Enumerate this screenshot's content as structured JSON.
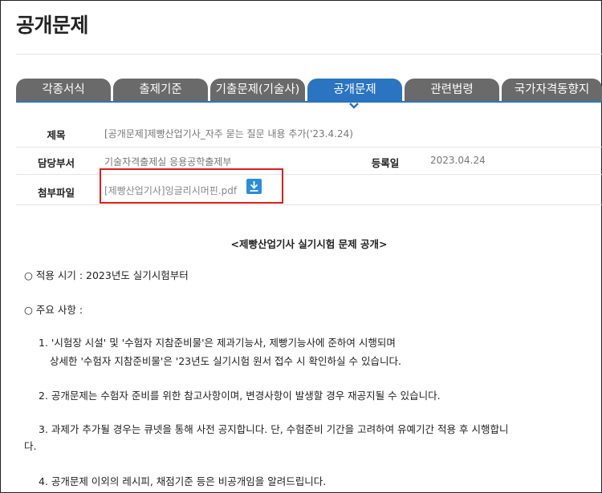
{
  "page": {
    "title": "공개문제"
  },
  "tabs": [
    {
      "label": "각종서식",
      "active": false
    },
    {
      "label": "출제기준",
      "active": false
    },
    {
      "label": "기출문제(기술사)",
      "active": false
    },
    {
      "label": "공개문제",
      "active": true
    },
    {
      "label": "관련법령",
      "active": false
    },
    {
      "label": "국가자격동향지",
      "active": false
    }
  ],
  "info": {
    "subject_label": "제목",
    "subject_value": "[공개문제]제빵산업기사_자주 묻는 질문 내용 추가('23.4.24)",
    "dept_label": "담당부서",
    "dept_value": "기술자격출제실 응용공학출제부",
    "date_label": "등록일",
    "date_value": "2023.04.24",
    "attach_label": "첨부파일",
    "attach_file": "[제빵산업기사]잉글리시머핀.pdf",
    "download_icon": "download-icon"
  },
  "content": {
    "heading": "<제빵산업기사 실기시험 문제 공개>",
    "line1": "○ 적용 시기 : 2023년도 실기시험부터",
    "line2": "○ 주요 사항 :",
    "item1a": "1. '시험장 시설' 및 '수험자 지참준비물'은 제과기능사, 제빵기능사에 준하여 시행되며",
    "item1b": "상세한 '수험자 지참준비물'은 '23년도 실기시험 원서 접수 시 확인하실 수 있습니다.",
    "item2": "2. 공개문제는 수험자 준비를 위한 참고사항이며, 변경사항이 발생할 경우 재공지될 수 있습니다.",
    "item3a": "3. 과제가 추가될 경우는 큐넷을 통해 사전 공지합니다. 단, 수험준비 기간을 고려하여 유예기간 적용 후 시행합니",
    "item3b": "다.",
    "item4": "4. 공개문제 이외의 레시피, 채점기준 등은 비공개임을 알려드립니다."
  },
  "colors": {
    "tab_active": "#2a74c2",
    "tab_inactive": "#6a6a6a",
    "highlight": "#e21b1b",
    "download": "#2a8cdc"
  }
}
